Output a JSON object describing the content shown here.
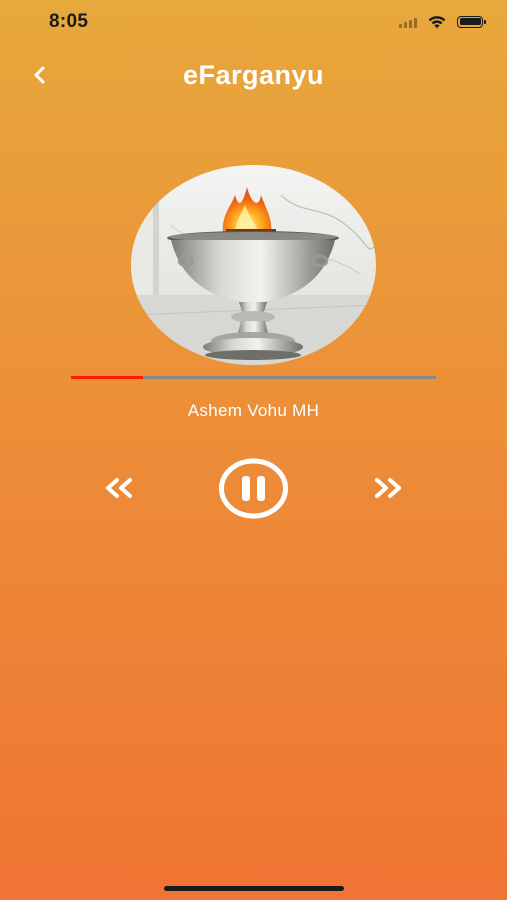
{
  "status_bar": {
    "time": "8:05"
  },
  "nav": {
    "title": "eFarganyu",
    "back_icon": "chevron-left-icon"
  },
  "player": {
    "artwork_description_icon": "fire-altar-image",
    "track_title": "Ashem Vohu MH",
    "progress_fraction": 0.197,
    "is_playing": true
  },
  "controls": {
    "rewind_icon": "rewind-icon",
    "pause_icon": "pause-circle-icon",
    "forward_icon": "fast-forward-icon"
  },
  "colors": {
    "background_top": "#E7A83C",
    "background_bottom": "#F07434",
    "progress_played": "#FF1A00",
    "progress_track": "#8a8a8a",
    "foreground": "#FFFFFF"
  }
}
